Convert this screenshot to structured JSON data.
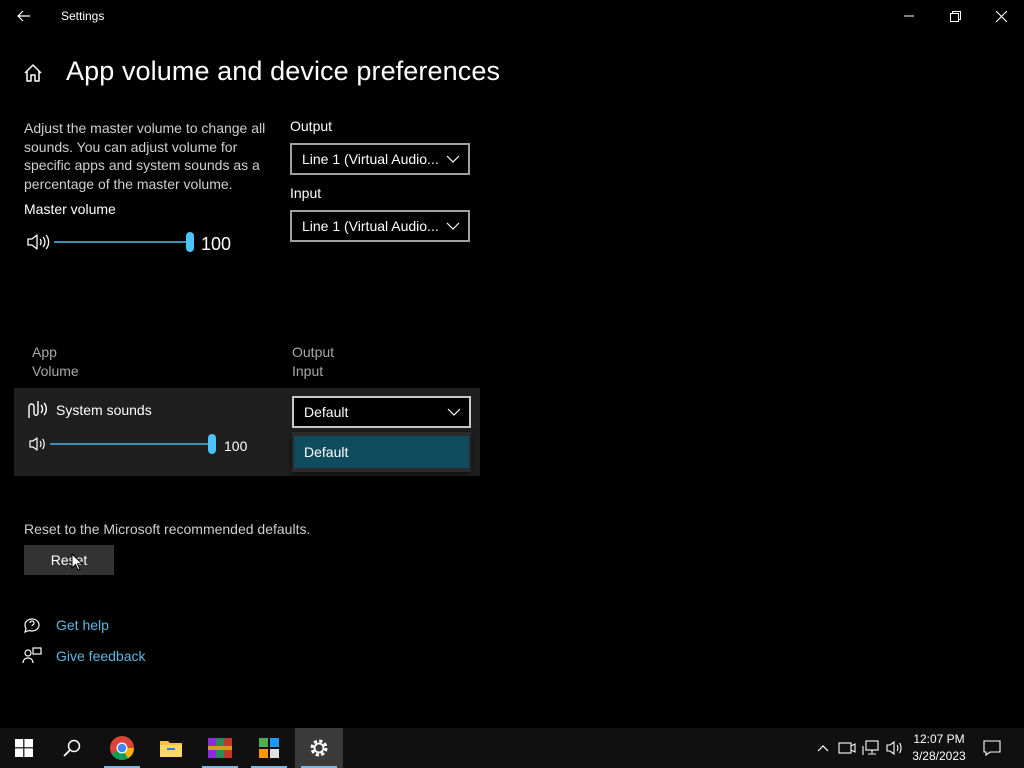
{
  "window": {
    "title": "Settings"
  },
  "page": {
    "title": "App volume and device preferences"
  },
  "master": {
    "description": "Adjust the master volume to change all sounds. You can adjust volume for specific apps and system sounds as a percentage of the master volume.",
    "label": "Master volume",
    "value_text": "100",
    "level": 1.0
  },
  "output": {
    "label": "Output",
    "value": "Line 1 (Virtual Audio..."
  },
  "input": {
    "label": "Input",
    "value": "Line 1 (Virtual Audio..."
  },
  "columns": {
    "app": "App",
    "volume": "Volume",
    "output": "Output",
    "input": "Input"
  },
  "apps": [
    {
      "name": "System sounds",
      "volume_text": "100",
      "level": 1.0,
      "output_dropdown": {
        "selected": "Default",
        "options": [
          "Default"
        ],
        "highlighted": "Default"
      }
    }
  ],
  "reset": {
    "description": "Reset to the Microsoft recommended defaults.",
    "button_label": "Reset"
  },
  "links": {
    "help": "Get help",
    "feedback": "Give feedback"
  },
  "taskbar": {
    "apps": [
      "start-icon",
      "search-icon",
      "chrome-icon",
      "file-explorer-icon",
      "winrar-icon",
      "app-icon",
      "settings-icon"
    ],
    "active": "settings-icon",
    "time": "12:07 PM",
    "date": "3/28/2023"
  },
  "colors": {
    "accent": "#4cc2ff",
    "link": "#5fb8e0",
    "selected_item": "#0f4d5e"
  }
}
